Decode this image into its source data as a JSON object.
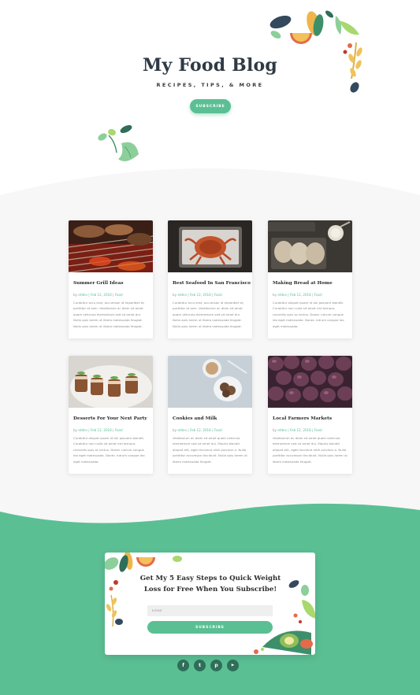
{
  "hero": {
    "title": "My Food Blog",
    "tagline": "RECIPES, TIPS, & MORE",
    "subscribe_label": "SUBSCRIBE"
  },
  "posts": [
    {
      "title": "Summer Grill Ideas",
      "author": "etdev",
      "date": "Feb 12, 2018",
      "category": "Food",
      "excerpt": "Curabitur arcu erat, accumsan id imperdiet et, porttitor at sem. Vestibulum ac diam sit amet quam vehicula elementum sed sit amet dui. Nulla quis lorem ut libero malesuada feugiat. Nulla quis lorem ut libero malesuada feugiat.",
      "image": "grill-photo"
    },
    {
      "title": "Best Seafood In San Francisco",
      "author": "etdev",
      "date": "Feb 12, 2018",
      "category": "Food",
      "excerpt": "Curabitur arcu erat, accumsan id imperdiet et, porttitor at sem. Vestibulum ac diam sit amet quam vehicula elementum sed sit amet dui. Nulla quis lorem ut libero malesuada feugiat. Nulla quis lorem ut libero malesuada feugiat.",
      "image": "crab-photo"
    },
    {
      "title": "Making Bread at Home",
      "author": "etdev",
      "date": "Feb 12, 2018",
      "category": "Food",
      "excerpt": "Curabitur aliquet quam id dui posuere blandit. Curabitur non nulla sit amet nisl tempus convallis quis ac lectus. Donec rutrum congue leo eget malesuada. Donec rutrum congue leo eget malesuada.",
      "image": "bread-photo"
    },
    {
      "title": "Desserts For Your Next Party",
      "author": "etdev",
      "date": "Feb 12, 2018",
      "category": "Food",
      "excerpt": "Curabitur aliquet quam id dui posuere blandit. Curabitur non nulla sit amet nisl tempus convallis quis ac lectus. Donec rutrum congue leo eget malesuada. Donec rutrum congue leo eget malesuada.",
      "image": "dessert-photo"
    },
    {
      "title": "Cookies and Milk",
      "author": "etdev",
      "date": "Feb 12, 2018",
      "category": "Food",
      "excerpt": "Vestibulum ac diam sit amet quam vehicula elementum sed sit amet dui. Mauris blandit aliquet elit, eget tincidunt nibh pulvinar a. Nulla porttitor accumsan tincidunt. Nulla quis lorem ut libero malesuada feugiat.",
      "image": "cookies-photo"
    },
    {
      "title": "Local Farmers Markets",
      "author": "etdev",
      "date": "Feb 12, 2018",
      "category": "Food",
      "excerpt": "Vestibulum ac diam sit amet quam vehicula elementum sed sit amet dui. Mauris blandit aliquet elit, eget tincidunt nibh pulvinar a. Nulla porttitor accumsan tincidunt. Nulla quis lorem ut libero malesuada feugiat.",
      "image": "figs-photo"
    }
  ],
  "optin": {
    "title": "Get My 5 Easy Steps to Quick Weight Loss for Free When You Subscribe!",
    "email_placeholder": "Email",
    "button_label": "SUBSCRIBE"
  },
  "socials": [
    {
      "icon": "facebook-icon",
      "glyph": "f"
    },
    {
      "icon": "twitter-icon",
      "glyph": "t"
    },
    {
      "icon": "pinterest-icon",
      "glyph": "p"
    },
    {
      "icon": "youtube-icon",
      "glyph": "▶"
    }
  ],
  "colors": {
    "accent": "#5bbf94",
    "grey_bg": "#f7f7f7",
    "social_bg": "#2f6e59",
    "title_text": "#2f3a45"
  }
}
